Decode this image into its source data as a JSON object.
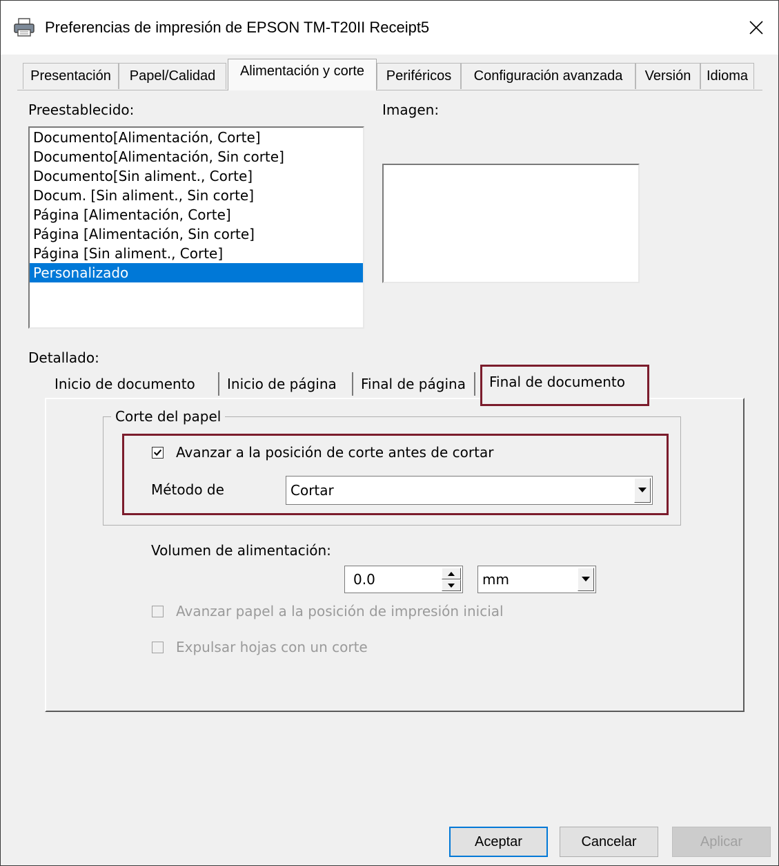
{
  "window": {
    "title": "Preferencias de impresión de EPSON TM-T20II Receipt5"
  },
  "tabs": [
    {
      "label": "Presentación"
    },
    {
      "label": "Papel/Calidad"
    },
    {
      "label": "Alimentación y corte"
    },
    {
      "label": "Periféricos"
    },
    {
      "label": "Configuración avanzada"
    },
    {
      "label": "Versión"
    },
    {
      "label": "Idioma"
    }
  ],
  "active_tab": "Alimentación y corte",
  "preset": {
    "label": "Preestablecido:",
    "items": [
      {
        "label": "Documento[Alimentación, Corte]"
      },
      {
        "label": "Documento[Alimentación, Sin corte]"
      },
      {
        "label": "Documento[Sin aliment., Corte]"
      },
      {
        "label": "Docum. [Sin aliment., Sin corte]"
      },
      {
        "label": "Página [Alimentación, Corte]"
      },
      {
        "label": "Página [Alimentación, Sin corte]"
      },
      {
        "label": "Página [Sin aliment., Corte]"
      },
      {
        "label": "Personalizado"
      }
    ],
    "selected": "Personalizado"
  },
  "image": {
    "label": "Imagen:"
  },
  "detail": {
    "label": "Detallado:",
    "subtabs": [
      {
        "label": "Inicio de documento"
      },
      {
        "label": "Inicio de página"
      },
      {
        "label": "Final de página"
      },
      {
        "label": "Final de documento"
      }
    ],
    "active_subtab": "Final de documento"
  },
  "paper_cut": {
    "group_label": "Corte del papel",
    "advance_checkbox": {
      "label": "Avanzar a la posición de corte antes de cortar",
      "checked": true
    },
    "method": {
      "label": "Método de",
      "value": "Cortar"
    }
  },
  "feed_volume": {
    "label": "Volumen de alimentación:",
    "value": "0.0",
    "unit": "mm"
  },
  "disabled_options": [
    {
      "label": "Avanzar papel a la posición de impresión inicial",
      "checked": false,
      "enabled": false
    },
    {
      "label": "Expulsar hojas con un corte",
      "checked": false,
      "enabled": false
    }
  ],
  "buttons": {
    "accept": "Aceptar",
    "cancel": "Cancelar",
    "apply": "Aplicar"
  },
  "colors": {
    "highlight_border": "#7b1c2c",
    "selection": "#0078d7"
  }
}
